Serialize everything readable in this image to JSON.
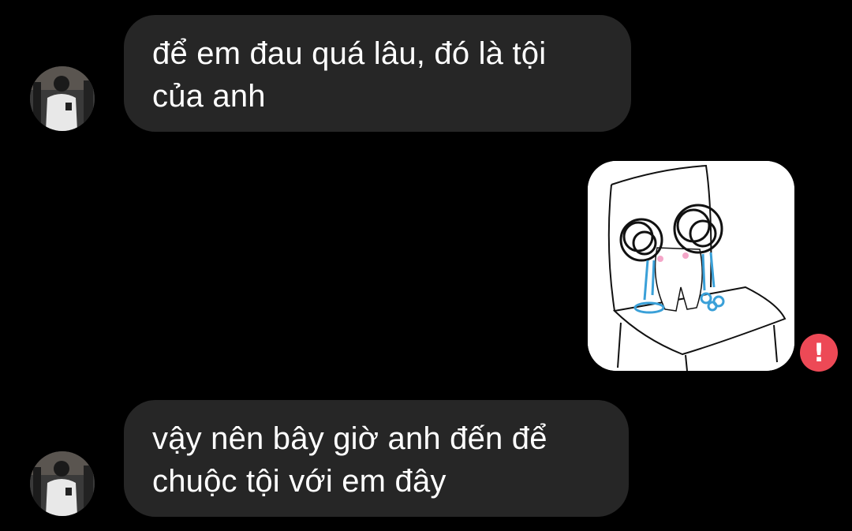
{
  "messages": [
    {
      "sender": "other",
      "type": "text",
      "text": "để em đau quá lâu, đó là tội của anh"
    },
    {
      "sender": "me",
      "type": "sticker",
      "sticker_icon": "crying-cat-on-chair-sticker",
      "status_icon": "error-icon",
      "status_symbol": "!"
    },
    {
      "sender": "other",
      "type": "text",
      "text": "vậy nên bây giờ anh đến để chuộc tội với em đây"
    }
  ],
  "colors": {
    "background": "#000000",
    "incoming_bubble": "#262626",
    "text": "#ffffff",
    "error": "#ed4956"
  }
}
